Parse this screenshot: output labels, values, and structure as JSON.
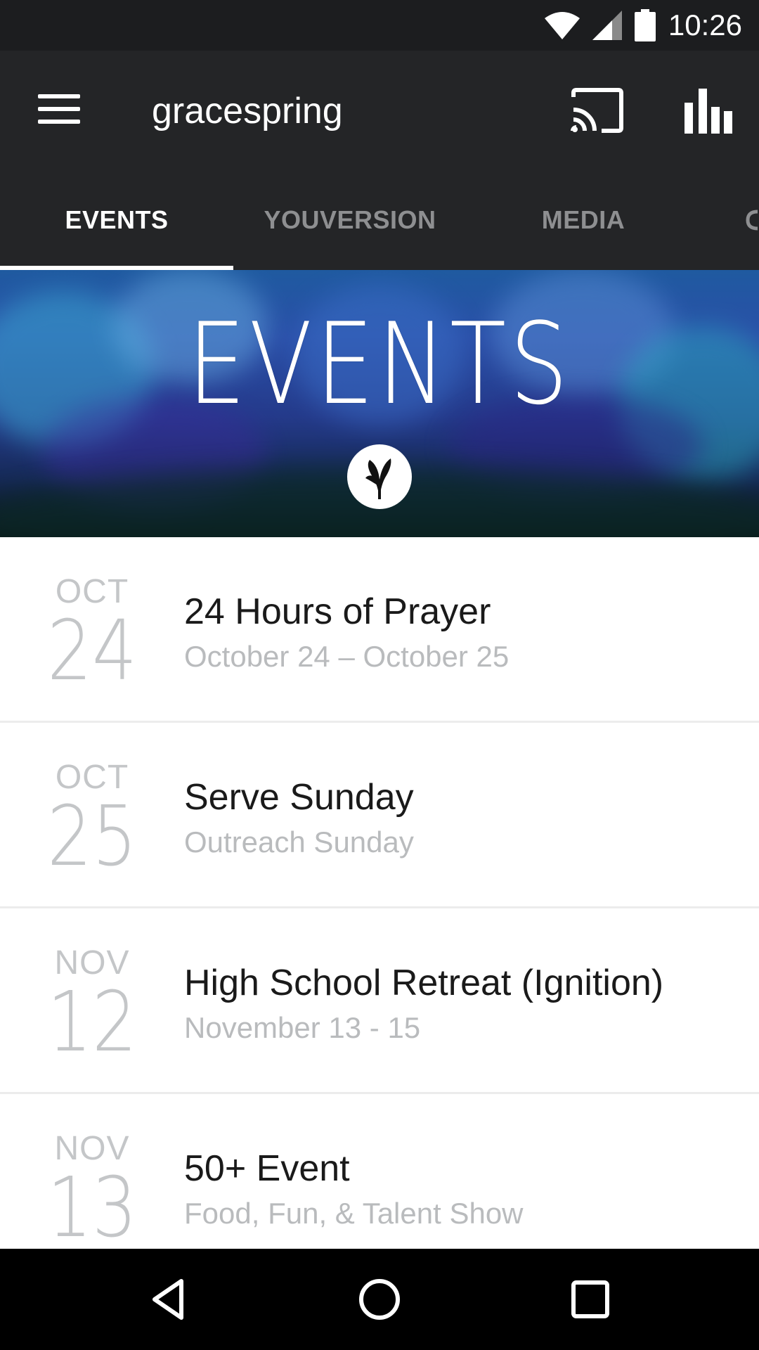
{
  "status_bar": {
    "time": "10:26",
    "icons": [
      "wifi-icon",
      "cell-signal-icon",
      "battery-icon"
    ]
  },
  "app_bar": {
    "title": "gracespring",
    "icons": [
      "menu-icon",
      "cast-icon",
      "bar-chart-icon"
    ]
  },
  "tabs": [
    {
      "label": "EVENTS",
      "active": true
    },
    {
      "label": "YOUVERSION",
      "active": false
    },
    {
      "label": "MEDIA",
      "active": false
    }
  ],
  "banner": {
    "title": "EVENTS"
  },
  "events": [
    {
      "month": "OCT",
      "day": "24",
      "title": "24 Hours of Prayer",
      "subtitle": "October 24 – October 25"
    },
    {
      "month": "OCT",
      "day": "25",
      "title": "Serve Sunday",
      "subtitle": "Outreach Sunday"
    },
    {
      "month": "NOV",
      "day": "12",
      "title": "High School Retreat (Ignition)",
      "subtitle": "November 13 - 15"
    },
    {
      "month": "NOV",
      "day": "13",
      "title": "50+ Event",
      "subtitle": "Food, Fun, & Talent Show"
    }
  ],
  "nav_bar": {
    "icons": [
      "back-icon",
      "home-icon",
      "recents-icon"
    ]
  },
  "colors": {
    "app_bar": "#242527",
    "status_bar": "#1c1d1f",
    "tab_inactive": "#8e8f91",
    "date_gray": "#c4c6c8",
    "subtitle_gray": "#b9bbbd"
  }
}
